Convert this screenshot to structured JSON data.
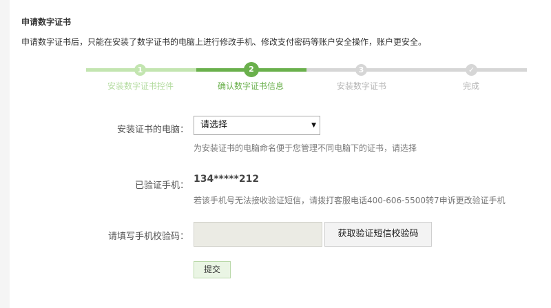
{
  "page": {
    "title": "申请数字证书",
    "description": "申请数字证书后，只能在安装了数字证书的电脑上进行修改手机、修改支付密码等账户安全操作，账户更安全。"
  },
  "steps": [
    {
      "number": "1",
      "label": "安装数字证书控件",
      "state": "done"
    },
    {
      "number": "2",
      "label": "确认数字证书信息",
      "state": "current"
    },
    {
      "number": "3",
      "label": "安装数字证书",
      "state": "pending"
    },
    {
      "number": "✓",
      "label": "完成",
      "state": "pending"
    }
  ],
  "form": {
    "computer": {
      "label": "安装证书的电脑：",
      "selected": "请选择",
      "hint": "为安装证书的电脑命名便于您管理不同电脑下的证书，请选择"
    },
    "phone": {
      "label": "已验证手机：",
      "value": "134*****212",
      "hint": "若该手机号无法接收验证短信，请拨打客服电话400-606-5500转7申诉更改验证手机"
    },
    "verify_code": {
      "label": "请填写手机校验码：",
      "value": "",
      "get_code_label": "获取验证短信校验码"
    },
    "submit_label": "提交"
  },
  "colors": {
    "accent": "#6ab04c",
    "accent_light": "#c3e5b0",
    "pending": "#d6d6d6"
  }
}
